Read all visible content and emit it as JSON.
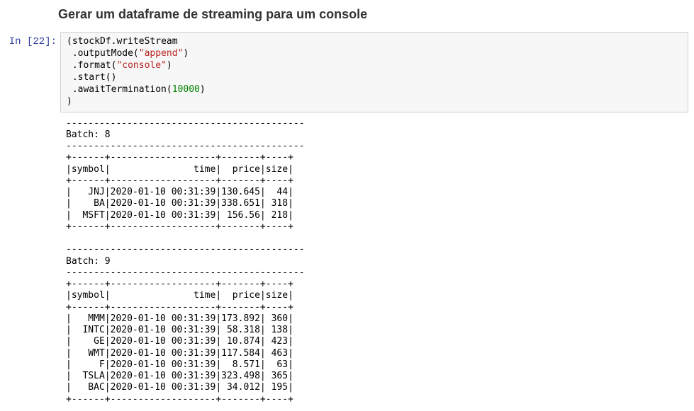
{
  "heading": "Gerar um dataframe de streaming para um console",
  "prompt": "In [22]:",
  "code": {
    "l1_a": "(stockDf",
    "l1_b": ".writeStream",
    "l2_a": " .outputMode(",
    "l2_b": "\"append\"",
    "l2_c": ")",
    "l3_a": " .format(",
    "l3_b": "\"console\"",
    "l3_c": ")",
    "l4": " .start()",
    "l5_a": " .awaitTermination(",
    "l5_b": "10000",
    "l5_c": ")",
    "l6": ")"
  },
  "output_lines": [
    "-------------------------------------------",
    "Batch: 8",
    "-------------------------------------------",
    "+------+-------------------+-------+----+",
    "|symbol|               time|  price|size|",
    "+------+-------------------+-------+----+",
    "|   JNJ|2020-01-10 00:31:39|130.645|  44|",
    "|    BA|2020-01-10 00:31:39|338.651| 318|",
    "|  MSFT|2020-01-10 00:31:39| 156.56| 218|",
    "+------+-------------------+-------+----+",
    "",
    "-------------------------------------------",
    "Batch: 9",
    "-------------------------------------------",
    "+------+-------------------+-------+----+",
    "|symbol|               time|  price|size|",
    "+------+-------------------+-------+----+",
    "|   MMM|2020-01-10 00:31:39|173.892| 360|",
    "|  INTC|2020-01-10 00:31:39| 58.318| 138|",
    "|    GE|2020-01-10 00:31:39| 10.874| 423|",
    "|   WMT|2020-01-10 00:31:39|117.584| 463|",
    "|     F|2020-01-10 00:31:39|  8.571|  63|",
    "|  TSLA|2020-01-10 00:31:39|323.498| 365|",
    "|   BAC|2020-01-10 00:31:39| 34.012| 195|",
    "+------+-------------------+-------+----+",
    ""
  ],
  "chart_data": {
    "type": "table",
    "batches": [
      {
        "number": 8,
        "columns": [
          "symbol",
          "time",
          "price",
          "size"
        ],
        "rows": [
          [
            "JNJ",
            "2020-01-10 00:31:39",
            130.645,
            44
          ],
          [
            "BA",
            "2020-01-10 00:31:39",
            338.651,
            318
          ],
          [
            "MSFT",
            "2020-01-10 00:31:39",
            156.56,
            218
          ]
        ]
      },
      {
        "number": 9,
        "columns": [
          "symbol",
          "time",
          "price",
          "size"
        ],
        "rows": [
          [
            "MMM",
            "2020-01-10 00:31:39",
            173.892,
            360
          ],
          [
            "INTC",
            "2020-01-10 00:31:39",
            58.318,
            138
          ],
          [
            "GE",
            "2020-01-10 00:31:39",
            10.874,
            423
          ],
          [
            "WMT",
            "2020-01-10 00:31:39",
            117.584,
            463
          ],
          [
            "F",
            "2020-01-10 00:31:39",
            8.571,
            63
          ],
          [
            "TSLA",
            "2020-01-10 00:31:39",
            323.498,
            365
          ],
          [
            "BAC",
            "2020-01-10 00:31:39",
            34.012,
            195
          ]
        ]
      }
    ]
  }
}
